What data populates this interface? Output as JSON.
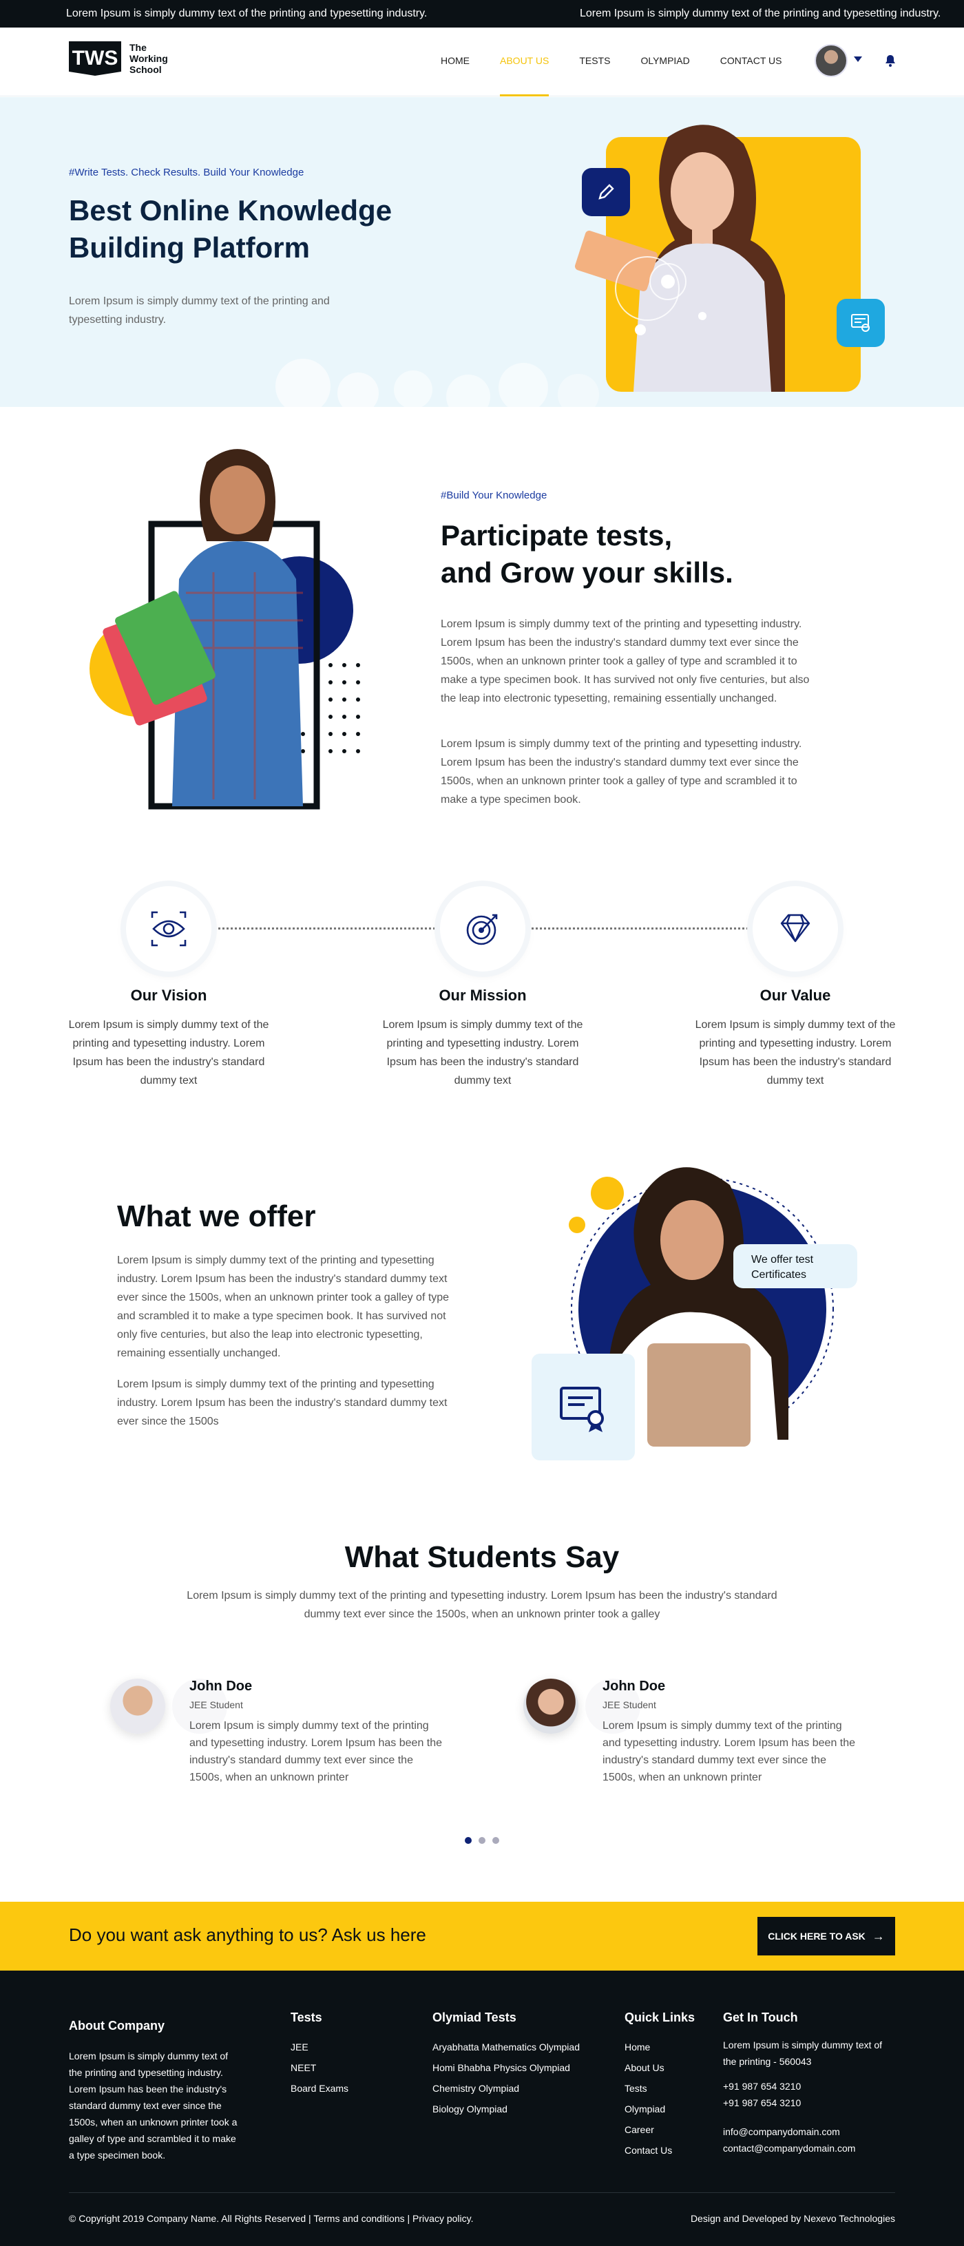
{
  "topbar": {
    "ticker_1": "Lorem Ipsum is simply dummy text of the printing and typesetting industry.",
    "ticker_2": "Lorem Ipsum is simply dummy text of the printing and typesetting industry."
  },
  "header": {
    "logo_mark": "TWS",
    "logo_text": "The Working School",
    "nav": [
      "HOME",
      "ABOUT US",
      "TESTS",
      "OLYMPIAD",
      "CONTACT US"
    ],
    "active_nav": "ABOUT US"
  },
  "hero": {
    "tagline": "#Write Tests. Check Results. Build Your Knowledge",
    "title_line1": "Best Online Knowledge",
    "title_line2": "Building Platform",
    "text": "Lorem Ipsum is simply dummy text of the printing and typesetting industry."
  },
  "participate": {
    "tagline": "#Build Your Knowledge",
    "title_line1": "Participate tests,",
    "title_line2": "and Grow your skills.",
    "para1": "Lorem Ipsum is simply dummy text of the printing and typesetting industry. Lorem Ipsum has been the industry's standard dummy text ever since the 1500s, when an unknown printer took a galley of type and scrambled it to make a type specimen book. It has survived not only five centuries, but also the leap into electronic typesetting, remaining essentially unchanged.",
    "para2": "Lorem Ipsum is simply dummy text of the printing and typesetting industry. Lorem Ipsum has been the industry's standard dummy text ever since the 1500s, when an unknown printer took a galley of type and scrambled it to make a type specimen book."
  },
  "values": [
    {
      "icon": "eye-target-icon",
      "title": "Our Vision",
      "text": "Lorem Ipsum is simply dummy text of the printing and typesetting industry. Lorem Ipsum has been the industry's standard dummy text"
    },
    {
      "icon": "target-icon",
      "title": "Our Mission",
      "text": "Lorem Ipsum is simply dummy text of the printing and typesetting industry. Lorem Ipsum has been the industry's standard dummy text"
    },
    {
      "icon": "diamond-icon",
      "title": "Our Value",
      "text": "Lorem Ipsum is simply dummy text of the printing and typesetting industry. Lorem Ipsum has been the industry's standard dummy text"
    }
  ],
  "offer": {
    "title": "What we offer",
    "para1": "Lorem Ipsum is simply dummy text of the printing and typesetting industry. Lorem Ipsum has been the industry's standard dummy text ever since the 1500s, when an unknown printer took a galley of type and scrambled it to make a type specimen book. It has survived not only five centuries, but also the leap into electronic typesetting, remaining essentially unchanged.",
    "para2": "Lorem Ipsum is simply dummy text of the printing and typesetting industry. Lorem Ipsum has been the industry's standard dummy text ever since the 1500s",
    "badge": "We offer test Certificates"
  },
  "testimonials": {
    "title": "What Students Say",
    "subtitle": "Lorem Ipsum is simply dummy text of the printing and typesetting industry. Lorem Ipsum has been the industry's standard dummy text ever since the 1500s, when an unknown printer took a galley",
    "items": [
      {
        "name": "John Doe",
        "role": "JEE Student",
        "text": "Lorem Ipsum is simply dummy text of the printing and typesetting industry. Lorem Ipsum has been the industry's standard dummy text ever since the 1500s, when an unknown printer"
      },
      {
        "name": "John Doe",
        "role": "JEE Student",
        "text": "Lorem Ipsum is simply dummy text of the printing and typesetting industry. Lorem Ipsum has been the industry's standard dummy text ever since the 1500s, when an unknown printer"
      }
    ]
  },
  "ask": {
    "text": "Do you want ask anything to us? Ask us here",
    "button": "CLICK HERE TO ASK",
    "arrow": "→"
  },
  "footer": {
    "about_title": "About Company",
    "about_text": "Lorem Ipsum is simply dummy text of the printing and typesetting industry. Lorem Ipsum has been the industry's standard dummy text ever since the 1500s, when an unknown printer took a galley of type and scrambled it to make a type specimen book.",
    "tests_title": "Tests",
    "tests": [
      "JEE",
      "NEET",
      "Board Exams"
    ],
    "olympiad_title": "Olymiad Tests",
    "olympiad": [
      "Aryabhatta Mathematics Olympiad",
      "Homi Bhabha Physics Olympiad",
      "Chemistry Olympiad",
      "Biology Olympiad"
    ],
    "quick_title": "Quick Links",
    "quick": [
      "Home",
      "About Us",
      "Tests",
      "Olympiad",
      "Career",
      "Contact Us"
    ],
    "contact_title": "Get In Touch",
    "address": "Lorem Ipsum is simply dummy text of the printing - 560043",
    "phone1": "+91 987 654 3210",
    "phone2": "+91 987 654 3210",
    "email1": "info@companydomain.com",
    "email2": "contact@companydomain.com",
    "copyright": "© Copyright 2019 Company Name. All Rights Reserved",
    "sep1": " | ",
    "terms": "Terms and conditions",
    "sep2": " | ",
    "privacy": "Privacy policy.",
    "credit": "Design and Developed by Nexevo Technologies"
  },
  "colors": {
    "accent": "#fcc80f",
    "navy": "#0e2275",
    "dark": "#0b1115",
    "hero_bg": "#eaf6fb",
    "sky": "#1fa8e0"
  }
}
